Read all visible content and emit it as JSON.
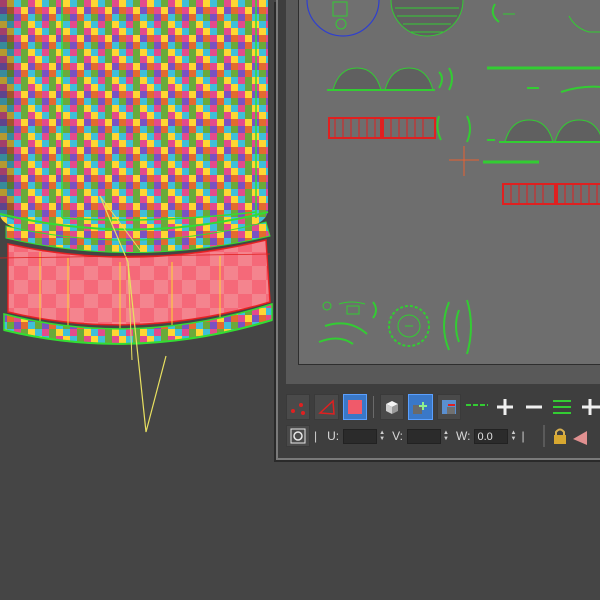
{
  "viewport": {
    "name": "3D viewport",
    "background_color": "#454545"
  },
  "uv_editor": {
    "canvas_color": "#6e6e6e",
    "shell_color": "#33cc33",
    "selected_color": "#e02020",
    "toolbar": {
      "tools": [
        {
          "name": "vertex-mode-icon",
          "active": false
        },
        {
          "name": "edge-mode-icon",
          "active": false
        },
        {
          "name": "polygon-mode-icon",
          "active": true
        },
        {
          "name": "element-mode-icon",
          "active": false
        },
        {
          "name": "rotate-plus-icon",
          "active": false
        },
        {
          "name": "rotate-minus-icon",
          "active": false
        },
        {
          "name": "freeform-icon",
          "active": false
        },
        {
          "name": "grow-icon",
          "active": false
        },
        {
          "name": "shrink-icon",
          "active": false
        },
        {
          "name": "loop-icon",
          "active": false
        },
        {
          "name": "ring-icon",
          "active": false
        }
      ]
    },
    "coords": {
      "u_label": "U:",
      "u_value": "",
      "v_label": "V:",
      "v_value": "",
      "w_label": "W:",
      "w_value": "0.0",
      "separator": "|"
    }
  }
}
